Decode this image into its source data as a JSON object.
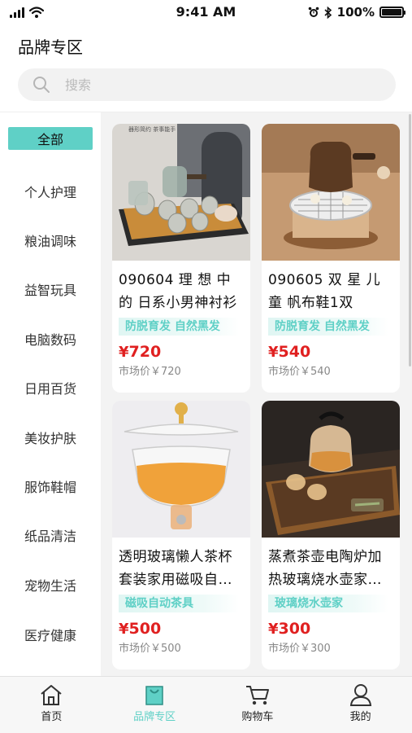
{
  "status_bar": {
    "time": "9:41 AM",
    "battery": "100%",
    "battery_level": 1.0
  },
  "header": {
    "title": "品牌专区"
  },
  "search": {
    "placeholder": "搜索",
    "value": ""
  },
  "sidebar": {
    "items": [
      {
        "label": "全部",
        "active": true
      },
      {
        "label": "个人护理"
      },
      {
        "label": "粮油调味"
      },
      {
        "label": "益智玩具"
      },
      {
        "label": "电脑数码"
      },
      {
        "label": "日用百货"
      },
      {
        "label": "美妆护肤"
      },
      {
        "label": "服饰鞋帽"
      },
      {
        "label": "纸品清洁"
      },
      {
        "label": "宠物生活"
      },
      {
        "label": "医疗健康"
      }
    ]
  },
  "products": [
    {
      "name": "090604 理 想 中 的 日系小男神衬衫",
      "tag": "防脱育发 自然黑发",
      "currency": "¥",
      "price": "720",
      "market_price": "市场价￥720",
      "image_text": "器形简约 茶事能手",
      "image": "tea-set-tray"
    },
    {
      "name": "090605 双 星 儿 童 帆布鞋1双",
      "tag": "防脱育发 自然黑发",
      "currency": "¥",
      "price": "540",
      "market_price": "市场价￥540",
      "image": "clay-pot-grill"
    },
    {
      "name": "透明玻璃懒人茶杯套装家用磁吸自…",
      "tag": "磁吸自动茶具",
      "currency": "¥",
      "price": "500",
      "market_price": "市场价￥500",
      "image": "glass-tea-cup"
    },
    {
      "name": "蒸煮茶壶电陶炉加热玻璃烧水壶家…",
      "tag": "玻璃烧水壶家",
      "currency": "¥",
      "price": "300",
      "market_price": "市场价￥300",
      "image": "glass-kettle"
    }
  ],
  "tabbar": {
    "tabs": [
      {
        "label": "首页",
        "icon": "home-icon"
      },
      {
        "label": "品牌专区",
        "icon": "bag-icon",
        "active": true
      },
      {
        "label": "购物车",
        "icon": "cart-icon"
      },
      {
        "label": "我的",
        "icon": "user-icon"
      }
    ]
  },
  "colors": {
    "accent": "#5fd0c6",
    "price": "#e02020",
    "content_bg": "#f3f3f3"
  }
}
